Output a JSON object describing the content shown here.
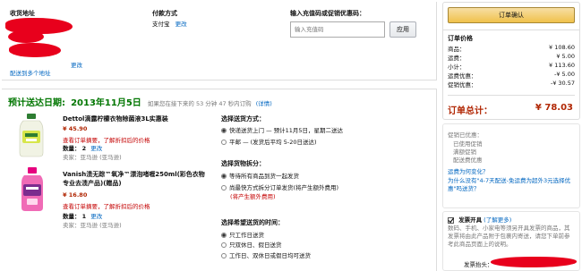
{
  "address": {
    "title": "收货地址",
    "change_link": "更改",
    "other_link": "配送到多个地址"
  },
  "payment": {
    "title": "付款方式",
    "value": "支付宝",
    "change_link": "更改"
  },
  "coupon": {
    "title": "输入充值码或促销优惠码：",
    "placeholder": "输入充值码",
    "apply_label": "应用"
  },
  "shipment": {
    "delivery_prefix": "预计送达日期:",
    "delivery_date": "2013年11月5日",
    "note": "如果您在接下来的 53 分钟 47 秒内订购",
    "details_link": "(详情)",
    "items": [
      {
        "name": "Dettol滴露柠檬衣物除菌液3L实惠装",
        "price": "¥ 45.90",
        "discount_link": "查看订单摘要，了解折扣后的价格",
        "qty_label": "数量：",
        "qty": "2",
        "change_link": "更改",
        "seller": "卖家：亚马逊 (亚马逊)"
      },
      {
        "name": "Vanish渍无踪™氧净™漂泡啫喱250ml(彩色衣物专业去渍产品)(赠品)",
        "price": "¥ 16.80",
        "discount_link": "查看订单摘要，了解折扣后的价格",
        "qty_label": "数量：",
        "qty": "1",
        "change_link": "更改",
        "seller": "卖家：亚马逊 (亚马逊)"
      }
    ],
    "shipping_method": {
      "title": "选择送货方式：",
      "options": [
        {
          "label": "快递送货上门 — 预计11月5日，星期二送达",
          "checked": true
        },
        {
          "label": "平邮 — (发货后平均 5-20日送达)",
          "checked": false
        }
      ]
    },
    "split": {
      "title": "选择货物拆分：",
      "options": [
        {
          "label": "等待所有商品到货一起发货",
          "checked": true
        },
        {
          "label": "尚最快方式拆分订单发货(将产生额外费用)",
          "checked": false
        }
      ],
      "option2_line2": "(将产生额外费用)"
    },
    "time": {
      "title": "选择希望送货的时间：",
      "options": [
        {
          "label": "只工作日送货",
          "checked": true
        },
        {
          "label": "只双休日、假日送货",
          "checked": false
        },
        {
          "label": "工作日、双休日或假日均可送货",
          "checked": false
        }
      ]
    }
  },
  "summary": {
    "place_order_label": "订单确认",
    "title": "订单价格",
    "lines": [
      {
        "label": "商品：",
        "value": "¥ 108.60"
      },
      {
        "label": "运费：",
        "value": "¥ 5.00"
      },
      {
        "label": "小计：",
        "value": "¥ 113.60"
      },
      {
        "label": "运费优惠：",
        "value": "-¥ 5.00"
      },
      {
        "label": "促销优惠：",
        "value": "-¥ 30.57"
      }
    ],
    "total_label": "订单总计：",
    "total_value": "¥ 78.03"
  },
  "info": {
    "lines": [
      "促销已优惠：",
      "已使用促销",
      "满额促销",
      "配送费优惠"
    ],
    "link1": "运费为何变化？",
    "link2": "为什么没有\"4-7天配送-免运费为超外3元选择优惠\"吗送货？",
    "gift_checkbox_label": "发票开具",
    "gift_link": "(了解更多)",
    "gift_text": "数码、手机、小家电等须另开具发票的商品，其发票将由此产品附于包裹内寄送，请您下单前参考此商品页面上的说明。",
    "footer_label": "发票抬头："
  },
  "colors": {
    "green": "#007600",
    "price_red": "#b12704",
    "link_blue": "#0066c0",
    "button_yellow": "#f0c14b",
    "redaction_red": "#e8001c"
  }
}
